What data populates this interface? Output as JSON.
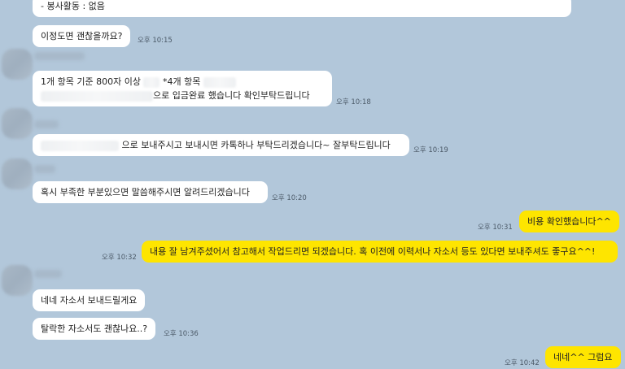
{
  "messages": {
    "m0": {
      "text": "- 봉사활동 : 없음"
    },
    "m1": {
      "text": "이정도면 괜찮을까요?",
      "time": "오후 10:15"
    },
    "m2": {
      "line1_a": "1개 항목 기준 800자 이상",
      "line1_b": "*4개 항목",
      "line2": "으로 입금완료 했습니다 확인부탁드립니다",
      "time": "오후 10:18"
    },
    "m3": {
      "text": "으로 보내주시고 보내시면 카톡하나 부탁드리겠습니다~ 잘부탁드립니다",
      "time": "오후 10:19"
    },
    "m4": {
      "text": "혹시 부족한 부분있으면 말씀해주시면 알려드리겠습니다",
      "time": "오후 10:20"
    },
    "m5": {
      "text": "비용 확인했습니다^^",
      "time": "오후 10:31"
    },
    "m6": {
      "text": "내용 잘 남겨주셨어서 참고해서 작업드리면 되겠습니다. 혹 이전에 이력서나 자소서 등도 있다면 보내주셔도 좋구요^^!",
      "time": "오후 10:32"
    },
    "m7": {
      "text": "네네 자소서 보내드릴게요"
    },
    "m8": {
      "text": "탈락한 자소서도 괜찮나요..?",
      "time": "오후 10:36"
    },
    "m9": {
      "text": "네네^^ 그럼요",
      "time": "오후 10:42"
    }
  },
  "colors": {
    "background": "#b2c7da",
    "incoming": "#ffffff",
    "outgoing": "#fee500"
  }
}
